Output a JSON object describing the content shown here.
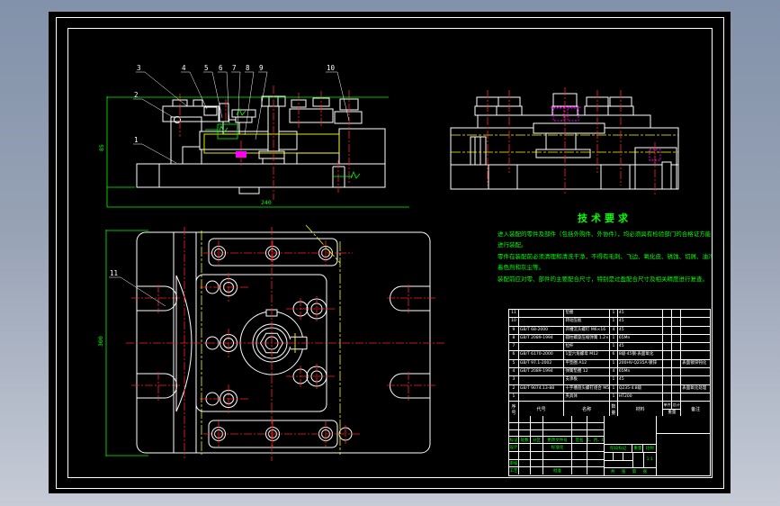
{
  "window": {
    "background_top": "#8292aa",
    "background_bottom": "#c6cbd6",
    "sheet_color": "#000000"
  },
  "colors": {
    "outline": "#ffffff",
    "hatch": "#00e8e8",
    "centerline": "#ff2222",
    "phantom": "#ffff00",
    "dimension": "#00ff00",
    "detail": "#ff00ff"
  },
  "callouts": {
    "items": [
      "1",
      "2",
      "3",
      "4",
      "5",
      "6",
      "7",
      "8",
      "9",
      "10",
      "11"
    ]
  },
  "dimensions": {
    "front_height": "85",
    "front_width": "240",
    "plan_height": "300"
  },
  "tech_requirements": {
    "title": "技术要求",
    "lines": [
      "进入装配的零件及部件（包括外购件、外协件），均必须具有检验部门的合格证方能",
      "进行装配。",
      "零件在装配前必须清理和清洗干净，不得有毛刺、飞边、氧化皮、锈蚀、切屑、油污、",
      "着色剂和灰尘等。",
      "装配前应对零、部件的主要配合尺寸，特别是过盈配合尺寸及相关精度进行复查。"
    ]
  },
  "bom": {
    "headers": {
      "no": "序号",
      "code": "代号",
      "name": "名称",
      "qty": "数量",
      "material": "材料",
      "unit": "单件",
      "total": "总计",
      "weight": "重量",
      "note": "备注"
    },
    "rows": [
      {
        "no": "11",
        "code": "",
        "name": "垫圈",
        "qty": "1",
        "material": "45",
        "unit": "",
        "total": "",
        "note": ""
      },
      {
        "no": "10",
        "code": "",
        "name": "转动压板",
        "qty": "1",
        "material": "45",
        "unit": "",
        "total": "",
        "note": ""
      },
      {
        "no": "9",
        "code": "GB/T 68-2000",
        "name": "开槽沉头螺钉 M6×16",
        "qty": "4",
        "material": "45",
        "unit": "",
        "total": "",
        "note": ""
      },
      {
        "no": "8",
        "code": "GB/T 2089-1994",
        "name": "圆柱螺旋压缩弹簧 1.2×8×40",
        "qty": "1",
        "material": "65Mn",
        "unit": "",
        "total": "",
        "note": ""
      },
      {
        "no": "7",
        "code": "",
        "name": "拉杆",
        "qty": "1",
        "material": "45",
        "unit": "",
        "total": "",
        "note": ""
      },
      {
        "no": "6",
        "code": "GB/T 6170-2000",
        "name": "1型六角螺母 M12",
        "qty": "6",
        "material": "8级·45钢·表面氧化",
        "unit": "",
        "total": "",
        "note": ""
      },
      {
        "no": "5",
        "code": "GB/T 97.1-2002",
        "name": "平垫圈 A12",
        "qty": "1",
        "material": "200HV·Q235A·镀锌",
        "unit": "",
        "total": "",
        "note": "表面镀锌钝化"
      },
      {
        "no": "4",
        "code": "GB/T 2089-1994",
        "name": "弹簧垫圈 12",
        "qty": "4",
        "material": "65Mn",
        "unit": "",
        "total": "",
        "note": ""
      },
      {
        "no": "3",
        "code": "",
        "name": "支承板",
        "qty": "1",
        "material": "45",
        "unit": "",
        "total": "",
        "note": ""
      },
      {
        "no": "2",
        "code": "GB/T 9074.13-88",
        "name": "十字槽盘头螺钉组合 M5×16",
        "qty": "1",
        "material": "Q235·4.8级",
        "unit": "",
        "total": "",
        "note": "表面氧化处理"
      },
      {
        "no": "1",
        "code": "",
        "name": "夹具体",
        "qty": "1",
        "material": "HT200",
        "unit": "",
        "total": "",
        "note": ""
      }
    ]
  },
  "title_block": {
    "revision_headers": [
      "标记",
      "处数",
      "分区",
      "更改文件号",
      "签名",
      "年、月、日"
    ],
    "design": "设计",
    "standardization": "标准化",
    "review": "审核",
    "process": "工艺",
    "approve": "批准",
    "stage_mark": "阶段标记",
    "weight": "重量",
    "scale": "比例",
    "scale_value": "1:1",
    "sheets_label": "共 张 第 张"
  }
}
